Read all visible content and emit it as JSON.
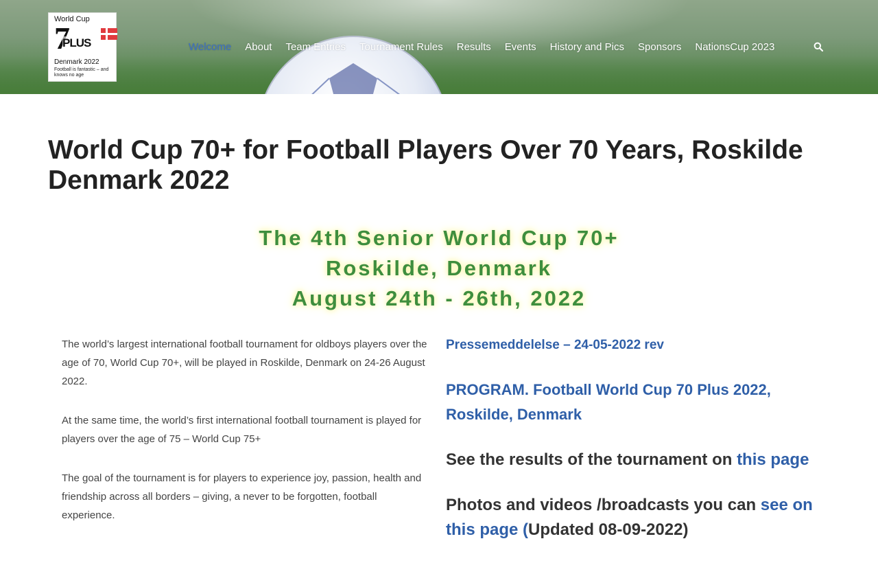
{
  "brand": {
    "logo_line1": "World Cup",
    "logo_number": "7",
    "logo_plus": "PLUS",
    "logo_country": "Denmark 2022",
    "logo_slogan": "Football is fantastic – and knows no age"
  },
  "nav": {
    "items": [
      {
        "label": "Welcome",
        "active": true
      },
      {
        "label": "About"
      },
      {
        "label": "Team Entries"
      },
      {
        "label": "Tournament Rules"
      },
      {
        "label": "Results"
      },
      {
        "label": "Events"
      },
      {
        "label": "History and Pics"
      },
      {
        "label": "Sponsors"
      },
      {
        "label": "NationsCup 2023"
      }
    ],
    "search_icon": "search-icon"
  },
  "page": {
    "title": "World Cup 70+ for Football Players Over 70 Years, Roskilde Denmark 2022"
  },
  "hero": {
    "line1": "The 4th Senior World Cup 70+",
    "line2": "Roskilde, Denmark",
    "line3": "August 24th - 26th, 2022"
  },
  "left": {
    "p1": "The world’s largest international football tournament for oldboys players over the age of 70, World Cup 70+, will be played in Roskilde, Denmark on 24-26 August 2022.",
    "p2": "At the same time, the world’s first international football tournament is played for players over the age of 75 – World Cup 75+",
    "p3": "The goal of the tournament is for players to experience joy, passion, health and friendship across all borders – giving, a never to be forgotten, football experience."
  },
  "right": {
    "press_link": "Pressemeddelelse – 24-05-2022 rev",
    "program_link": "PROGRAM. Football World Cup 70 Plus 2022, Roskilde, Denmark",
    "results_text": "See the results of the tournament on ",
    "results_link": "this page",
    "photos_text": "Photos and videos /broadcasts you can ",
    "photos_link": "see on this page  (",
    "photos_updated": "Updated 08-09-2022)"
  },
  "colors": {
    "nav_active": "#3c6fc4",
    "link": "#2f5fa8",
    "hero_green": "#3e8e3e"
  }
}
